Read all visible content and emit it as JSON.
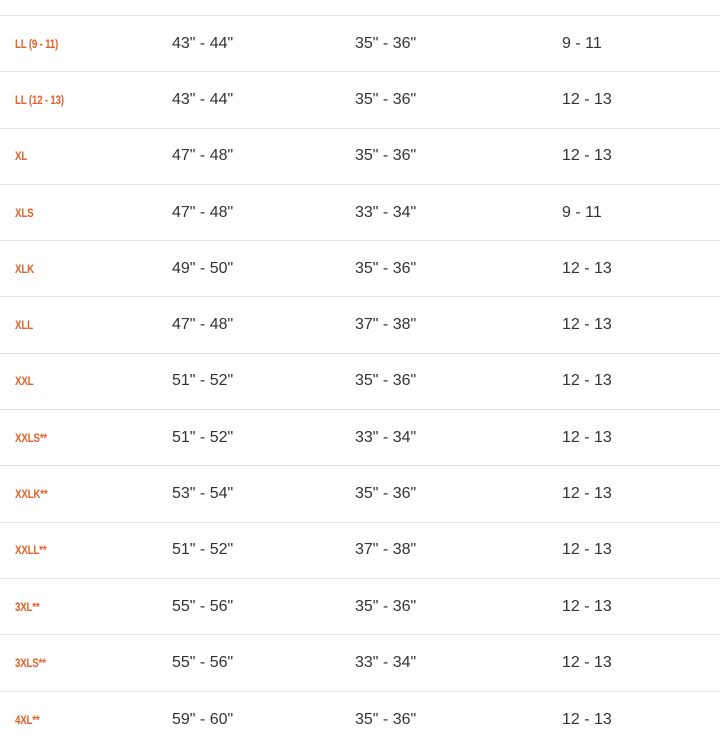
{
  "accent_color": "#e0612a",
  "text_color": "#333333",
  "rows": [
    {
      "size": "LL (9 - 11)",
      "chest": "43\" - 44\"",
      "length": "35\" - 36\"",
      "sleeve": "9 - 11"
    },
    {
      "size": "LL (12 - 13)",
      "chest": "43\" - 44\"",
      "length": "35\" - 36\"",
      "sleeve": "12 - 13"
    },
    {
      "size": "XL",
      "chest": "47\" - 48\"",
      "length": "35\" - 36\"",
      "sleeve": "12 - 13"
    },
    {
      "size": "XLS",
      "chest": "47\" - 48\"",
      "length": "33\" - 34\"",
      "sleeve": "9 - 11"
    },
    {
      "size": "XLK",
      "chest": "49\" - 50\"",
      "length": "35\" - 36\"",
      "sleeve": "12 - 13"
    },
    {
      "size": "XLL",
      "chest": "47\" - 48\"",
      "length": "37\" - 38\"",
      "sleeve": "12 - 13"
    },
    {
      "size": "XXL",
      "chest": "51\" - 52\"",
      "length": "35\" - 36\"",
      "sleeve": "12 - 13"
    },
    {
      "size": "XXLS**",
      "chest": "51\" - 52\"",
      "length": "33\" - 34\"",
      "sleeve": "12 - 13"
    },
    {
      "size": "XXLK**",
      "chest": "53\" - 54\"",
      "length": "35\" - 36\"",
      "sleeve": "12 - 13"
    },
    {
      "size": "XXLL**",
      "chest": "51\" - 52\"",
      "length": "37\" - 38\"",
      "sleeve": "12 - 13"
    },
    {
      "size": "3XL**",
      "chest": "55\" - 56\"",
      "length": "35\" - 36\"",
      "sleeve": "12 - 13"
    },
    {
      "size": "3XLS**",
      "chest": "55\" - 56\"",
      "length": "33\" - 34\"",
      "sleeve": "12 - 13"
    },
    {
      "size": "4XL**",
      "chest": "59\" - 60\"",
      "length": "35\" - 36\"",
      "sleeve": "12 - 13"
    }
  ]
}
